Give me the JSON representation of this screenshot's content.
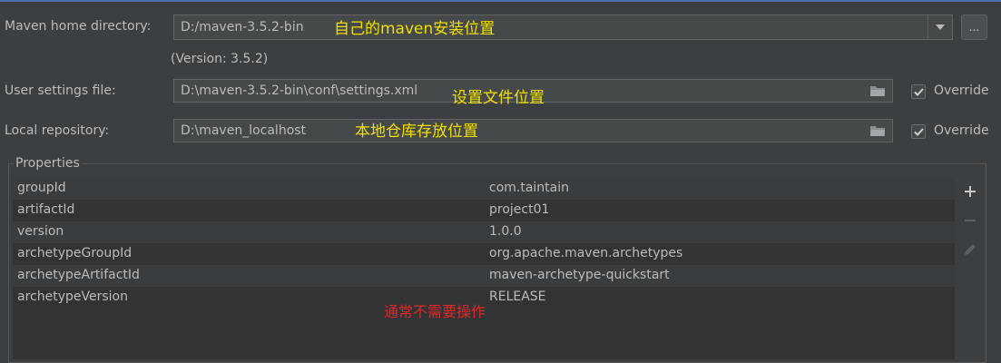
{
  "maven_home": {
    "label": "Maven home directory:",
    "value": "D:/maven-3.5.2-bin",
    "annotation": "自己的maven安装位置",
    "browse_label": "...",
    "version": "(Version: 3.5.2)"
  },
  "user_settings": {
    "label": "User settings file:",
    "value": "D:\\maven-3.5.2-bin\\conf\\settings.xml",
    "annotation": "设置文件位置",
    "override_label": "Override",
    "override_checked": true
  },
  "local_repo": {
    "label": "Local repository:",
    "value": "D:\\maven_localhost",
    "annotation": "本地仓库存放位置",
    "override_label": "Override",
    "override_checked": true
  },
  "properties": {
    "title": "Properties",
    "rows": [
      {
        "key": "groupId",
        "value": "com.taintain"
      },
      {
        "key": "artifactId",
        "value": "project01"
      },
      {
        "key": "version",
        "value": "1.0.0"
      },
      {
        "key": "archetypeGroupId",
        "value": "org.apache.maven.archetypes"
      },
      {
        "key": "archetypeArtifactId",
        "value": "maven-archetype-quickstart"
      },
      {
        "key": "archetypeVersion",
        "value": "RELEASE"
      }
    ],
    "annotation": "通常不需要操作"
  },
  "colors": {
    "background": "#3c3f41",
    "text": "#bbbbbb",
    "annotation_yellow": "#f0e000",
    "annotation_red": "#e02828"
  }
}
